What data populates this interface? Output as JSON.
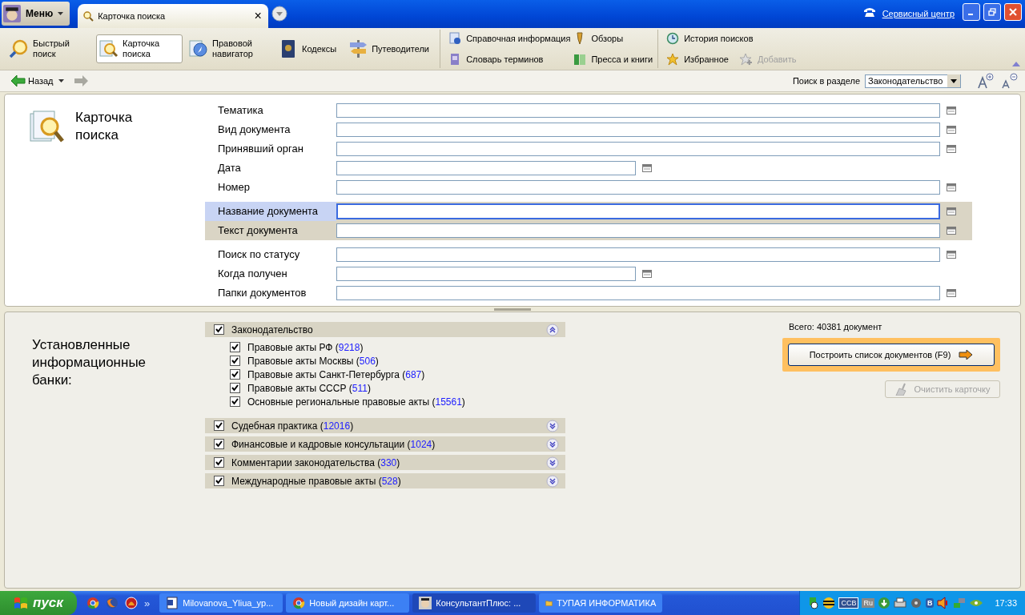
{
  "title_bar": {
    "menu": "Меню",
    "tab": {
      "label": "Карточка поиска",
      "close": "×"
    },
    "service_link": "Сервисный центр"
  },
  "toolbar": {
    "big": [
      {
        "label": "Быстрый поиск",
        "selected": false
      },
      {
        "label": "Карточка поиска",
        "selected": true
      },
      {
        "label": "Правовой навигатор",
        "selected": false
      },
      {
        "label": "Кодексы",
        "selected": false
      },
      {
        "label": "Путеводители",
        "selected": false
      }
    ],
    "columns": [
      [
        {
          "label": "Справочная информация",
          "disabled": false
        },
        {
          "label": "Словарь терминов",
          "disabled": false
        }
      ],
      [
        {
          "label": "Обзоры",
          "disabled": false
        },
        {
          "label": "Пресса и книги",
          "disabled": false
        }
      ],
      [
        {
          "label": "История поисков",
          "disabled": false
        },
        {
          "label": "Избранное",
          "disabled": false
        },
        {
          "label": "Добавить",
          "disabled": true
        }
      ]
    ]
  },
  "nav": {
    "back": "Назад",
    "section_label": "Поиск в разделе",
    "section_value": "Законодательство"
  },
  "search_card": {
    "title": "Карточка поиска",
    "fields": [
      {
        "label": "Тематика",
        "kind": "long",
        "selected": false,
        "highlighted": false
      },
      {
        "label": "Вид документа",
        "kind": "long",
        "selected": false,
        "highlighted": false
      },
      {
        "label": "Принявший орган",
        "kind": "long",
        "selected": false,
        "highlighted": false
      },
      {
        "label": "Дата",
        "kind": "short",
        "selected": false,
        "highlighted": false
      },
      {
        "label": "Номер",
        "kind": "long",
        "selected": false,
        "highlighted": false
      },
      {
        "label": "Название документа",
        "kind": "long",
        "selected": true,
        "highlighted": true
      },
      {
        "label": "Текст документа",
        "kind": "long",
        "selected": false,
        "highlighted": true
      },
      {
        "label": "Поиск по статусу",
        "kind": "long",
        "selected": false,
        "highlighted": false
      },
      {
        "label": "Когда получен",
        "kind": "short",
        "selected": false,
        "highlighted": false
      },
      {
        "label": "Папки документов",
        "kind": "long",
        "selected": false,
        "highlighted": false
      }
    ]
  },
  "banks": {
    "title": "Установленные информационные банки:",
    "groups": [
      {
        "label": "Законодательство",
        "checked": true,
        "expanded": true,
        "children": [
          {
            "label": "Правовые акты РФ",
            "open": "(",
            "count": "9218",
            "close": ")",
            "checked": true
          },
          {
            "label": "Правовые акты Москвы",
            "open": "(",
            "count": "506",
            "close": ")",
            "checked": true
          },
          {
            "label": "Правовые акты Санкт-Петербурга",
            "open": "(",
            "count": "687",
            "close": ")",
            "checked": true
          },
          {
            "label": "Правовые акты СССР",
            "open": "(",
            "count": "511",
            "close": ")",
            "checked": true
          },
          {
            "label": "Основные региональные правовые акты",
            "open": "(",
            "count": "15561",
            "close": ")",
            "checked": true
          }
        ]
      },
      {
        "label": "Судебная практика",
        "open": "(",
        "count": "12016",
        "close": ")",
        "checked": true,
        "expanded": false
      },
      {
        "label": "Финансовые и кадровые консультации",
        "open": "(",
        "count": "1024",
        "close": ")",
        "checked": true,
        "expanded": false
      },
      {
        "label": "Комментарии законодательства",
        "open": "(",
        "count": "330",
        "close": ")",
        "checked": true,
        "expanded": false
      },
      {
        "label": "Международные правовые акты",
        "open": "(",
        "count": "528",
        "close": ")",
        "checked": true,
        "expanded": false
      }
    ],
    "total": "Всего: 40381 документ",
    "build_button": "Построить список документов (F9)",
    "clear_button": {
      "label": "Очистить карточку",
      "disabled": true
    }
  },
  "taskbar": {
    "start": "пуск",
    "chevron": "»",
    "tasks": [
      {
        "label": "Milovanova_Yliua_yp...",
        "selected": false
      },
      {
        "label": "Новый дизайн карт...",
        "selected": false
      },
      {
        "label": "КонсультантПлюс: ...",
        "selected": true
      },
      {
        "label": "ТУПАЯ ИНФОРМАТИКА",
        "selected": false
      }
    ],
    "tray_tags": [
      "CCB",
      "Ru",
      "B"
    ],
    "clock": "17:33"
  }
}
